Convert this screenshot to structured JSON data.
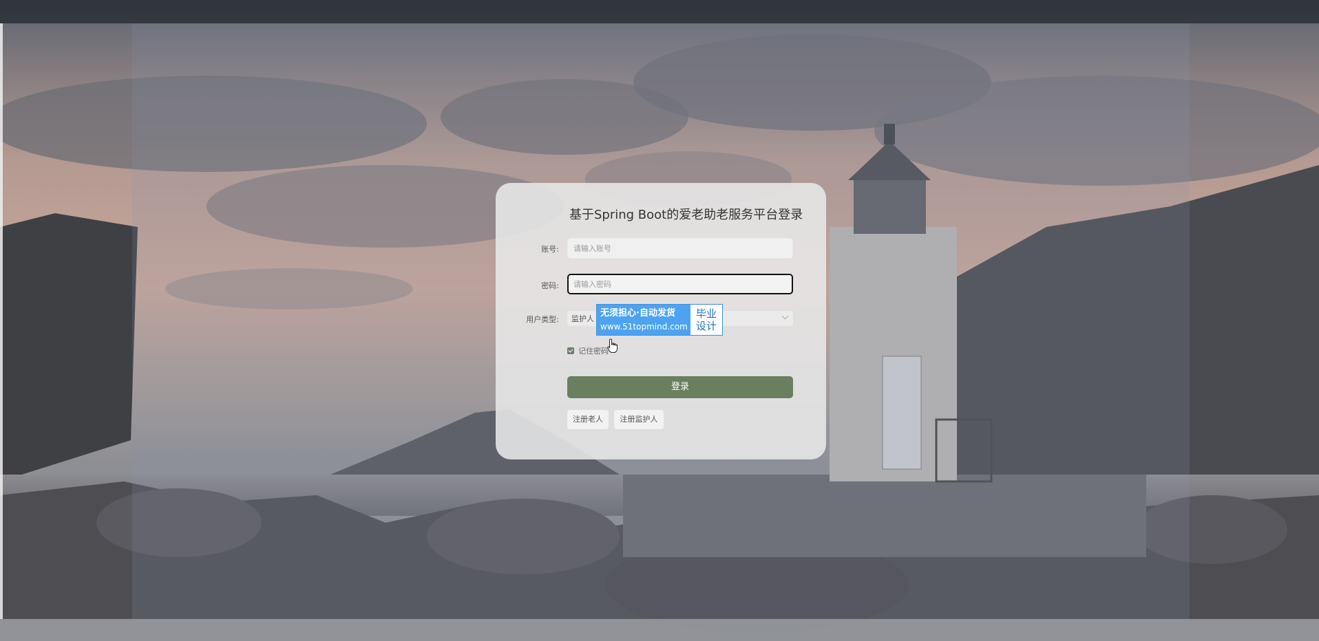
{
  "login": {
    "title": "基于Spring Boot的爱老助老服务平台登录",
    "account_label": "账号:",
    "account_placeholder": "请输入账号",
    "password_label": "密码:",
    "password_placeholder": "请输入密码",
    "user_type_label": "用户类型:",
    "user_type_value": "监护人",
    "remember_label": "记住密码",
    "remember_checked": true,
    "login_button": "登录",
    "register_elder_button": "注册老人",
    "register_guardian_button": "注册监护人"
  },
  "ad_badge": {
    "line1": "无须担心·自动发货",
    "line2": "www.51topmind.com",
    "right_line1": "毕业",
    "right_line2": "设计"
  },
  "colors": {
    "login_button": "#6a7f60",
    "card_background": "#e8e8e8",
    "ad_blue": "#4da3f0"
  }
}
